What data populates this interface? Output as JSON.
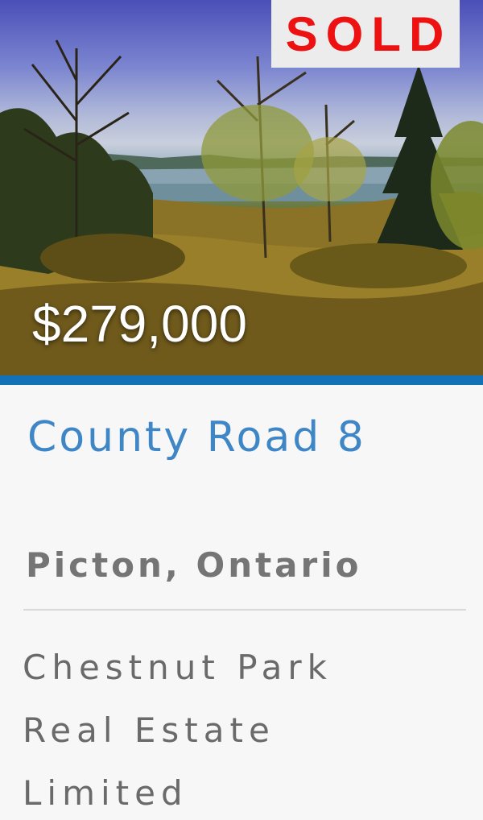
{
  "listing": {
    "status_badge": "SOLD",
    "price": "$279,000",
    "address": "County Road 8",
    "location": "Picton, Ontario",
    "brokerage": "Chestnut Park Real Estate Limited",
    "photo_alt": "Waterfront land with trees and tall grass",
    "colors": {
      "accent": "#1271b7",
      "address_text": "#3f86c6",
      "badge_text": "#ee1111",
      "badge_bg": "#ececec"
    }
  }
}
